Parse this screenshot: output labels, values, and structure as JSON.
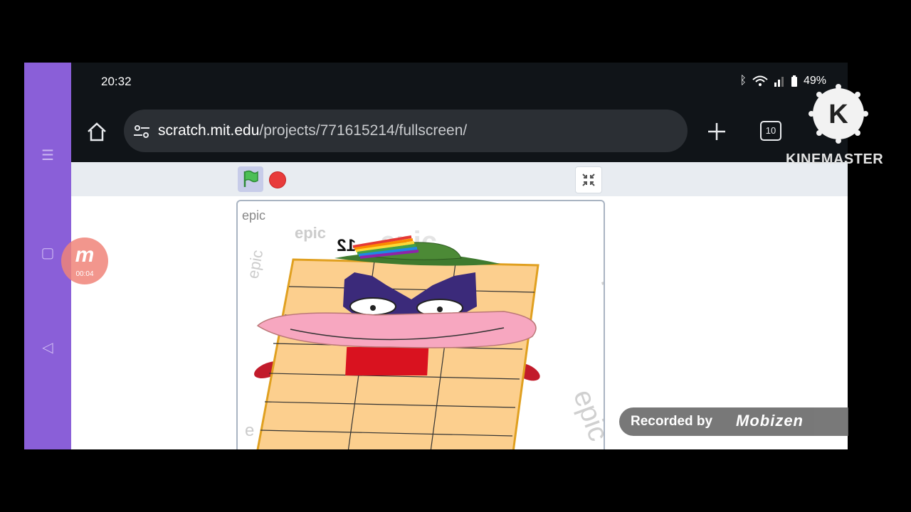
{
  "status": {
    "time": "20:32",
    "battery": "49%"
  },
  "browser": {
    "url_domain": "scratch.mit.edu",
    "url_path": "/projects/771615214/fullscreen/",
    "tab_count": "10"
  },
  "stage": {
    "top_label": "epic",
    "watermark_text": "epic",
    "character_number": "12"
  },
  "overlays": {
    "kinemaster_label": "KINEMASTER",
    "kinemaster_logo_letter": "K",
    "mobizen_badge_letter": "m",
    "mobizen_timer": "00:04",
    "recorded_by": "Recorded by",
    "recorder_brand": "Mobizen"
  },
  "colors": {
    "accent_purple": "#8a5fd8",
    "stop_red": "#e83b3b",
    "flag_green": "#4cbf56",
    "block_fill": "#fccf8e",
    "block_edge": "#e0a020"
  }
}
